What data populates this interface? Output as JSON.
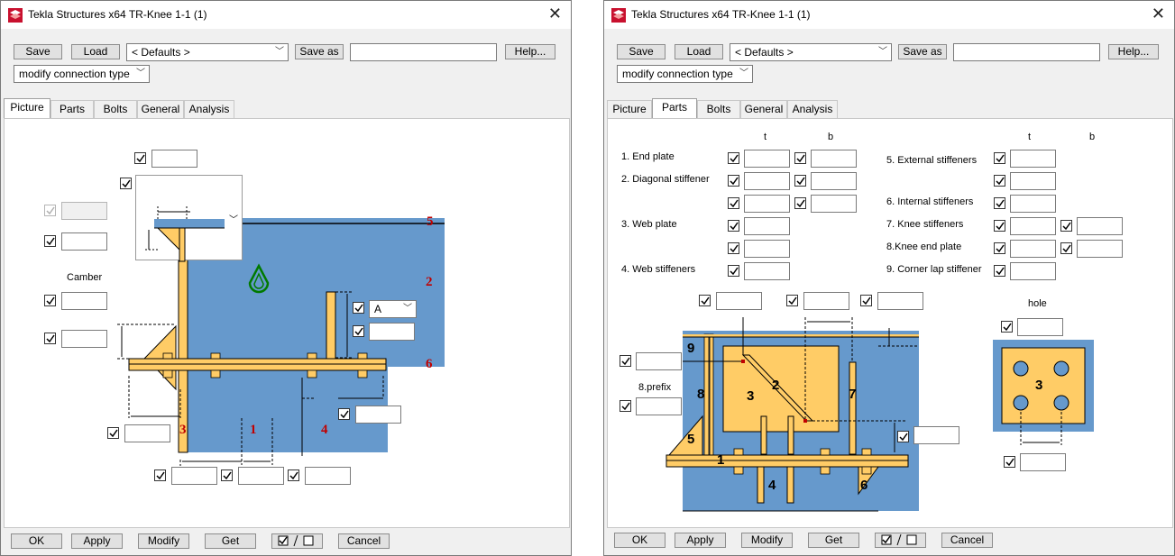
{
  "left_window": {
    "title": "Tekla Structures x64  TR-Knee 1-1 (1)",
    "buttons": {
      "save": "Save",
      "load": "Load",
      "save_as": "Save as",
      "help": "Help..."
    },
    "defaults_select": "< Defaults >",
    "save_as_value": "",
    "mode_select": "modify connection type",
    "tabs": [
      "Picture",
      "Parts",
      "Bolts",
      "General",
      "Analysis"
    ],
    "active_tab": "Picture",
    "camber_label": "Camber",
    "combo_value": "A",
    "red_numbers": [
      "5",
      "2",
      "6",
      "3",
      "1",
      "4"
    ],
    "footer": {
      "ok": "OK",
      "apply": "Apply",
      "modify": "Modify",
      "get": "Get",
      "cancel": "Cancel"
    }
  },
  "right_window": {
    "title": "Tekla Structures x64  TR-Knee 1-1 (1)",
    "buttons": {
      "save": "Save",
      "load": "Load",
      "save_as": "Save as",
      "help": "Help..."
    },
    "defaults_select": "< Defaults >",
    "save_as_value": "",
    "mode_select": "modify connection type",
    "tabs": [
      "Picture",
      "Parts",
      "Bolts",
      "General",
      "Analysis"
    ],
    "active_tab": "Parts",
    "col_t": "t",
    "col_b": "b",
    "parts_left": [
      "1. End plate",
      "2. Diagonal stiffener",
      "3. Web plate",
      "4. Web stiffeners"
    ],
    "parts_right": [
      "5. External stiffeners",
      "6. Internal stiffeners",
      "7. Knee stiffeners",
      "8.Knee end plate",
      "9. Corner lap stiffener"
    ],
    "prefix_label": "8.prefix",
    "hole_label": "hole",
    "diagram_numbers": [
      "9",
      "8",
      "3",
      "2",
      "7",
      "5",
      "1",
      "4",
      "6"
    ],
    "hole_number": "3",
    "footer": {
      "ok": "OK",
      "apply": "Apply",
      "modify": "Modify",
      "get": "Get",
      "cancel": "Cancel"
    }
  },
  "colors": {
    "steel_blue": "#6699cc",
    "plate_yellow": "#ffcc66",
    "dimension_red": "#c00000"
  }
}
